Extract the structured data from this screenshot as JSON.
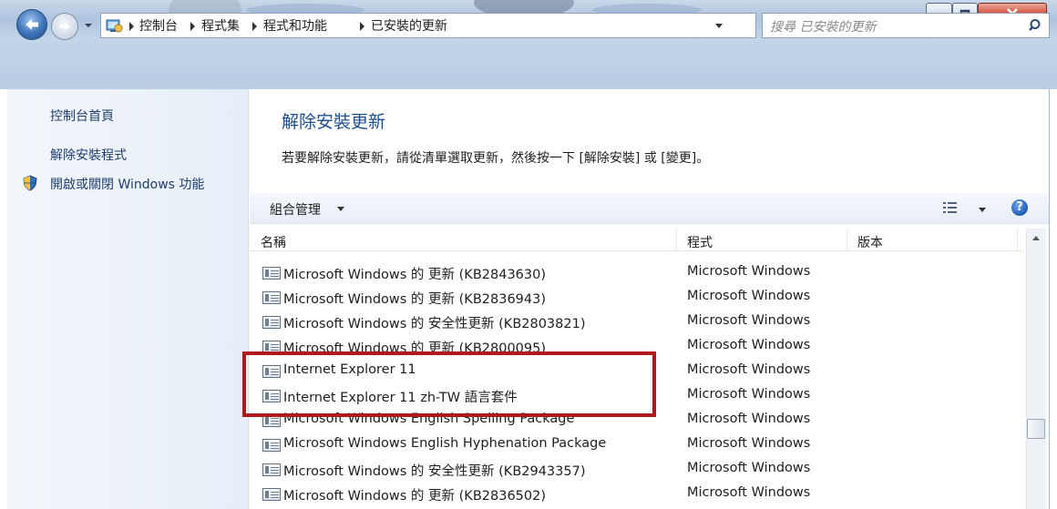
{
  "window": {
    "minimize_icon": "minimize-icon",
    "maximize_icon": "maximize-icon",
    "close_icon": "close-icon",
    "close_color": "#c2331a"
  },
  "address_bar": {
    "crumbs": [
      "控制台",
      "程式集",
      "程式和功能",
      "已安裝的更新"
    ],
    "search_placeholder": "搜尋 已安裝的更新"
  },
  "sidebar": {
    "items": [
      {
        "label": "控制台首頁"
      },
      {
        "label": "解除安裝程式"
      },
      {
        "label": "開啟或關閉 Windows 功能",
        "icon": "shield-icon"
      }
    ]
  },
  "main": {
    "title": "解除安裝更新",
    "instruction": "若要解除安裝更新，請從清單選取更新，然後按一下 [解除安裝] 或 [變更]。"
  },
  "toolbar": {
    "organize_label": "組合管理"
  },
  "table": {
    "columns": [
      "名稱",
      "程式",
      "版本"
    ],
    "rows": [
      {
        "name": "Microsoft Windows 的 更新 (KB2843630)",
        "program": "Microsoft Windows",
        "version": ""
      },
      {
        "name": "Microsoft Windows 的 更新 (KB2836943)",
        "program": "Microsoft Windows",
        "version": ""
      },
      {
        "name": "Microsoft Windows 的 安全性更新 (KB2803821)",
        "program": "Microsoft Windows",
        "version": ""
      },
      {
        "name": "Microsoft Windows 的 更新 (KB2800095)",
        "program": "Microsoft Windows",
        "version": ""
      },
      {
        "name": "Internet Explorer 11",
        "program": "Microsoft Windows",
        "version": ""
      },
      {
        "name": "Internet Explorer 11 zh-TW 語言套件",
        "program": "Microsoft Windows",
        "version": ""
      },
      {
        "name": "Microsoft Windows English Spelling Package",
        "program": "Microsoft Windows",
        "version": ""
      },
      {
        "name": "Microsoft Windows English Hyphenation Package",
        "program": "Microsoft Windows",
        "version": ""
      },
      {
        "name": "Microsoft Windows 的 安全性更新 (KB2943357)",
        "program": "Microsoft Windows",
        "version": ""
      },
      {
        "name": "Microsoft Windows 的 更新 (KB2836502)",
        "program": "Microsoft Windows",
        "version": ""
      }
    ]
  },
  "annotation": {
    "highlight_color": "#b0181c"
  }
}
